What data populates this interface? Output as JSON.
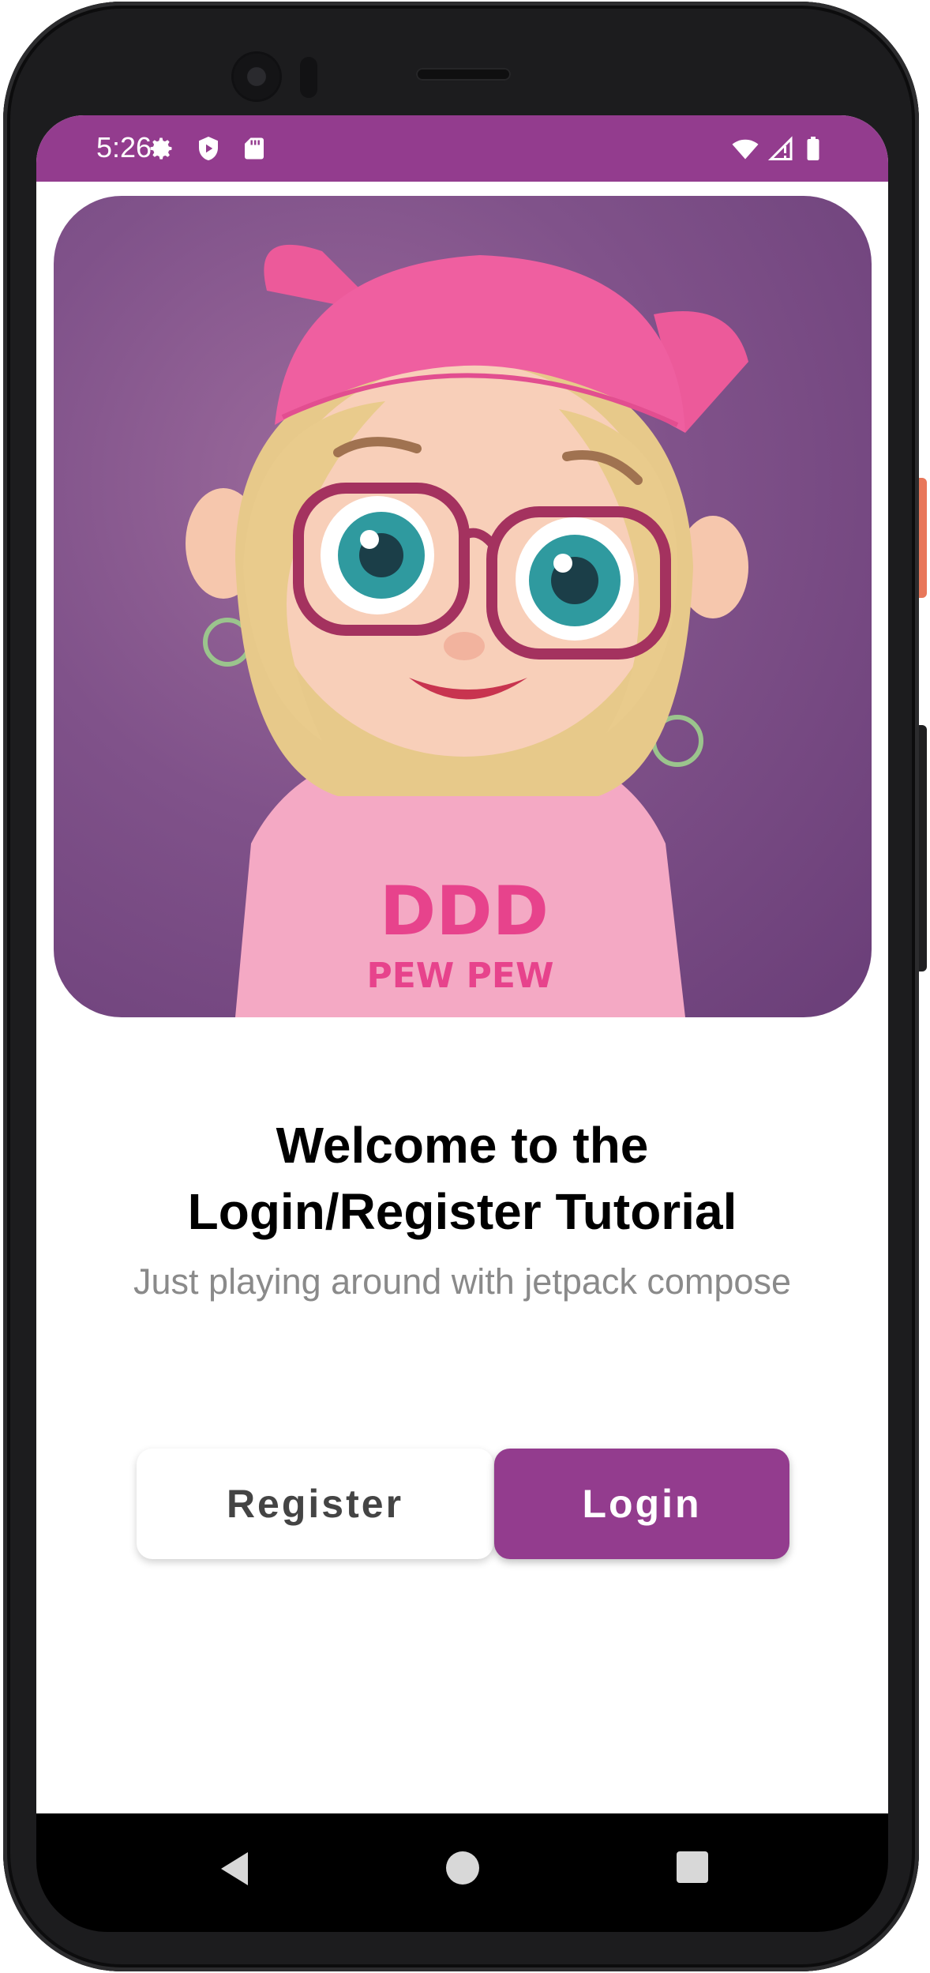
{
  "status_bar": {
    "time": "5:26",
    "background": "#933c8e",
    "icons": [
      "settings-gear-icon",
      "shield-play-icon",
      "sd-card-icon",
      "wifi-icon",
      "cell-signal-icon",
      "battery-icon"
    ]
  },
  "hero": {
    "shirt_text_top": "DDD",
    "shirt_text_bottom": "PEW PEW"
  },
  "welcome": {
    "title_line1": "Welcome to the",
    "title_line2": "Login/Register Tutorial",
    "subtitle": "Just playing around with jetpack compose"
  },
  "buttons": {
    "register_label": "Register",
    "login_label": "Login"
  },
  "nav_bar": {
    "icons": [
      "back-icon",
      "home-icon",
      "recents-icon"
    ]
  },
  "colors": {
    "accent": "#933c8e",
    "subtitle_text": "#8a8a8a"
  }
}
